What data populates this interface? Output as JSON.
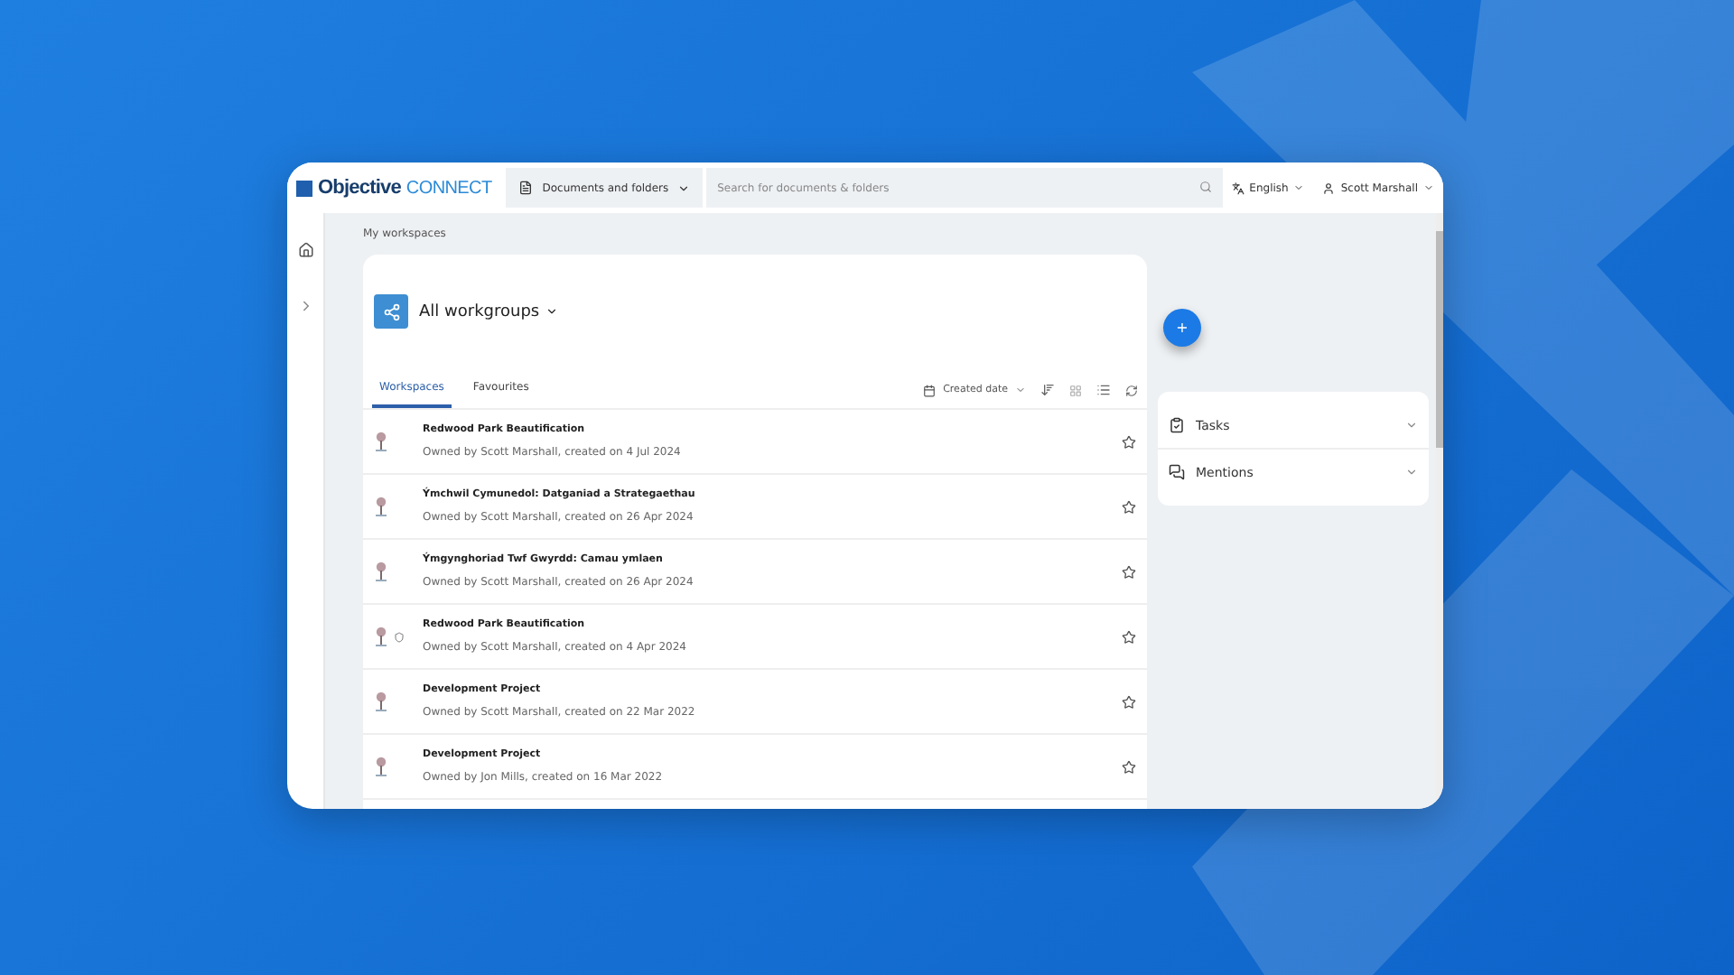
{
  "topbar": {
    "logo": {
      "brand": "Objective",
      "product": "CONNECT"
    },
    "scope": "Documents and folders",
    "search": {
      "placeholder": "Search for documents & folders"
    },
    "language": "English",
    "user": "Scott Marshall"
  },
  "breadcrumb": "My workspaces",
  "workgroup": {
    "title": "All workgroups"
  },
  "tabs": [
    {
      "label": "Workspaces",
      "selected": true
    },
    {
      "label": "Favourites",
      "selected": false
    }
  ],
  "sort": {
    "label": "Created date"
  },
  "workspaces": [
    {
      "name": "Redwood Park Beautification",
      "meta": "Owned by Scott Marshall, created on 4 Jul 2024",
      "shielded": false
    },
    {
      "name": "Ýmchwil Cymunedol: Datganiad a Strategaethau",
      "meta": "Owned by Scott Marshall, created on 26 Apr 2024",
      "shielded": false
    },
    {
      "name": "Ýmgynghoriad Twf Gwyrdd: Camau ymlaen",
      "meta": "Owned by Scott Marshall, created on 26 Apr 2024",
      "shielded": false
    },
    {
      "name": "Redwood Park Beautification",
      "meta": "Owned by Scott Marshall, created on 4 Apr 2024",
      "shielded": true
    },
    {
      "name": "Development Project",
      "meta": "Owned by Scott Marshall, created on 22 Mar 2022",
      "shielded": false
    },
    {
      "name": "Development Project",
      "meta": "Owned by Jon Mills, created on 16 Mar 2022",
      "shielded": false
    }
  ],
  "fab": "+",
  "panels": [
    {
      "kind": "tasks",
      "label": "Tasks",
      "expanded": false
    },
    {
      "kind": "mentions",
      "label": "Mentions",
      "expanded": false
    }
  ]
}
